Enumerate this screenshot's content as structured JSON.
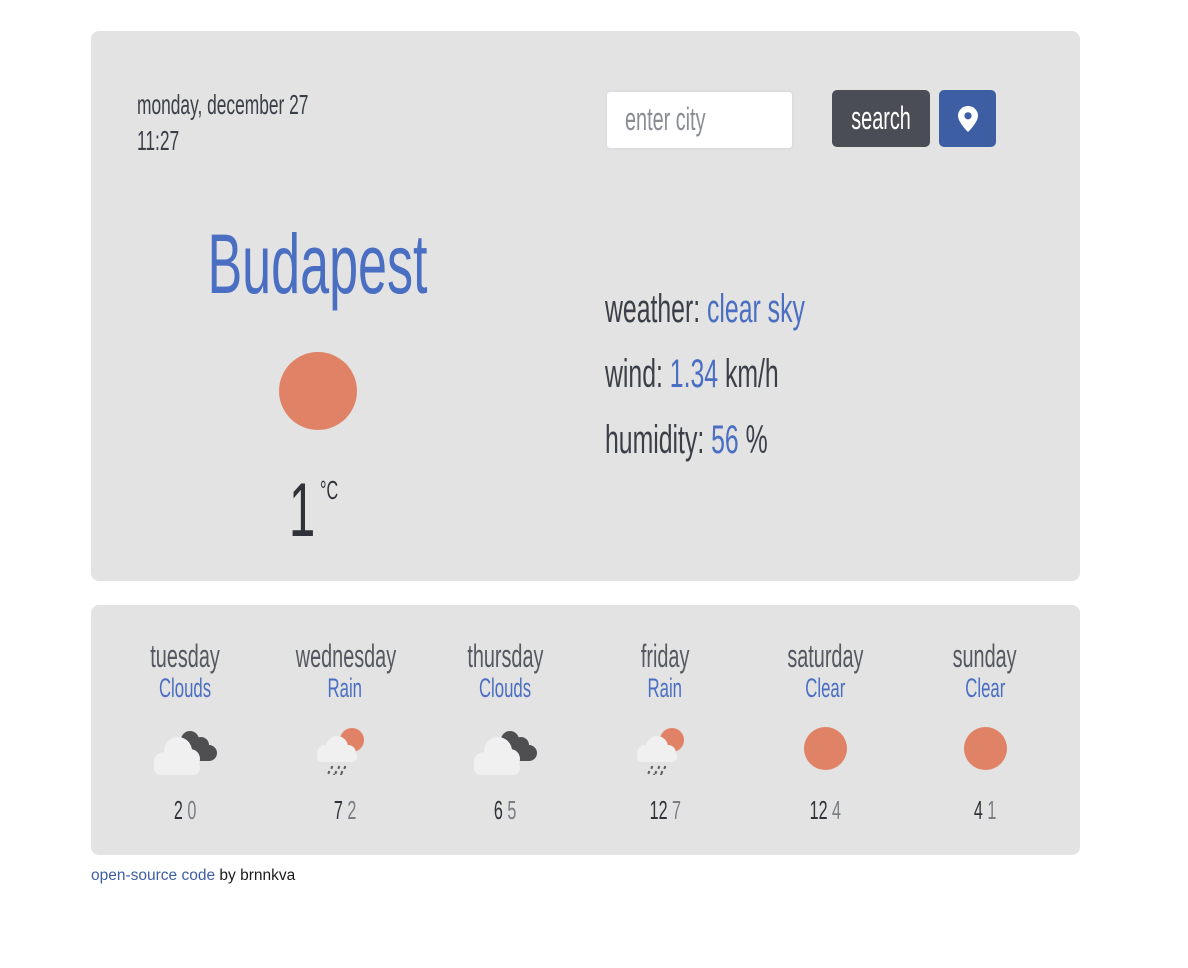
{
  "header": {
    "date": "monday, december 27",
    "time": "11:27"
  },
  "search": {
    "placeholder": "enter city",
    "value": "",
    "button_label": "search",
    "location_icon": "map-pin-icon"
  },
  "current": {
    "city": "Budapest",
    "icon": "sun-icon",
    "temperature": "1",
    "unit": "°C",
    "weather_label": "weather:",
    "weather_value": "clear sky",
    "wind_label": "wind:",
    "wind_value": "1.34",
    "wind_unit": "km/h",
    "humidity_label": "humidity:",
    "humidity_value": "56",
    "humidity_unit": "%"
  },
  "forecast": [
    {
      "day": "tuesday",
      "condition": "Clouds",
      "icon": "clouds-icon",
      "max": "2",
      "min": "0"
    },
    {
      "day": "wednesday",
      "condition": "Rain",
      "icon": "rain-icon",
      "max": "7",
      "min": "2"
    },
    {
      "day": "thursday",
      "condition": "Clouds",
      "icon": "clouds-icon",
      "max": "6",
      "min": "5"
    },
    {
      "day": "friday",
      "condition": "Rain",
      "icon": "rain-icon",
      "max": "12",
      "min": "7"
    },
    {
      "day": "saturday",
      "condition": "Clear",
      "icon": "sun-icon",
      "max": "12",
      "min": "4"
    },
    {
      "day": "sunday",
      "condition": "Clear",
      "icon": "sun-icon",
      "max": "4",
      "min": "1"
    }
  ],
  "footer": {
    "link_text": "open-source code",
    "suffix": " by brnnkva"
  },
  "colors": {
    "accent": "#4a6ec2",
    "sun": "#e08266",
    "card_bg": "#e3e3e3",
    "search_button": "#4a4d55",
    "location_button": "#3e5ea3"
  }
}
